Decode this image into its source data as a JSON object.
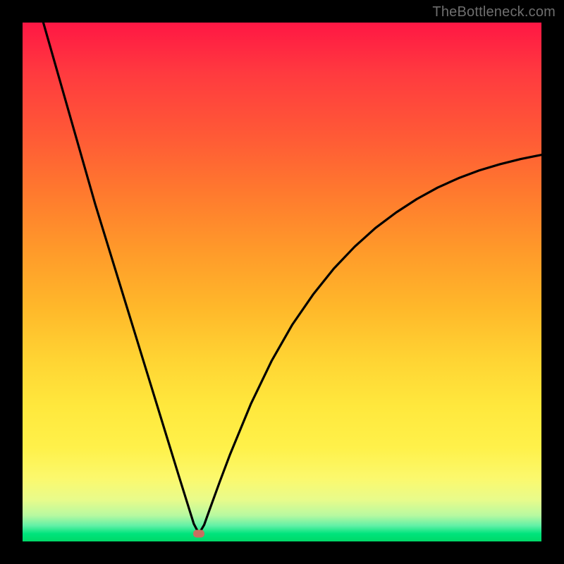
{
  "watermark": "TheBottleneck.com",
  "colors": {
    "frame": "#000000",
    "curve": "#000000",
    "marker": "#c96f60"
  },
  "chart_data": {
    "type": "line",
    "title": "",
    "xlabel": "",
    "ylabel": "",
    "xlim": [
      0,
      100
    ],
    "ylim": [
      0,
      100
    ],
    "grid": false,
    "legend": false,
    "annotations": [
      {
        "type": "marker",
        "x": 34,
        "y": 1.5,
        "shape": "rounded-rect",
        "color": "#c96f60"
      }
    ],
    "series": [
      {
        "name": "bottleneck-curve",
        "color": "#000000",
        "x": [
          4,
          6,
          8,
          10,
          12,
          14,
          16,
          18,
          20,
          22,
          24,
          26,
          28,
          30,
          31,
          32,
          33,
          34,
          35,
          36,
          38,
          40,
          44,
          48,
          52,
          56,
          60,
          64,
          68,
          72,
          76,
          80,
          84,
          88,
          92,
          96,
          100
        ],
        "y": [
          100,
          93,
          86,
          79,
          72,
          65,
          58.5,
          52,
          45.5,
          39,
          32.5,
          26,
          19.5,
          13,
          9.8,
          6.6,
          3.4,
          1.5,
          3.2,
          6.0,
          11.5,
          16.8,
          26.5,
          34.8,
          41.8,
          47.6,
          52.6,
          56.8,
          60.4,
          63.4,
          66.0,
          68.2,
          70.0,
          71.5,
          72.7,
          73.7,
          74.5
        ]
      }
    ]
  }
}
